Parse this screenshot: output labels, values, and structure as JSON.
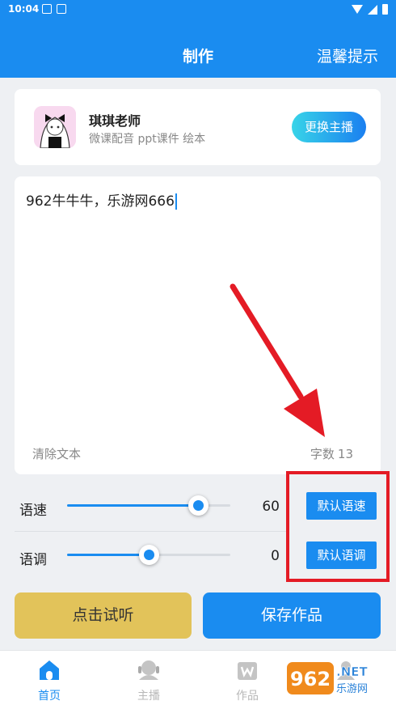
{
  "status_bar": {
    "time": "10:04"
  },
  "header": {
    "title": "制作",
    "tip_label": "温馨提示"
  },
  "anchor": {
    "name": "琪琪老师",
    "desc": "微课配音 ppt课件 绘本",
    "switch_label": "更换主播"
  },
  "editor": {
    "text": "962牛牛牛，乐游网666",
    "clear_label": "清除文本",
    "count_label": "字数",
    "count_value": "13"
  },
  "sliders": {
    "speed": {
      "label": "语速",
      "value": "60",
      "fraction": 0.8,
      "default_label": "默认语速"
    },
    "pitch": {
      "label": "语调",
      "value": "0",
      "fraction": 0.5,
      "default_label": "默认语调"
    }
  },
  "actions": {
    "listen_label": "点击试听",
    "save_label": "保存作品"
  },
  "tabbar": {
    "items": [
      {
        "label": "首页",
        "icon": "home-icon",
        "active": true
      },
      {
        "label": "主播",
        "icon": "headset-icon",
        "active": false
      },
      {
        "label": "作品",
        "icon": "works-icon",
        "active": false
      },
      {
        "label": "",
        "icon": "profile-icon",
        "active": false
      }
    ]
  },
  "watermark": {
    "brand": "962",
    "brand_suffix": ".NET",
    "site": "乐游网"
  },
  "colors": {
    "primary": "#1a8cf0",
    "listen": "#e2c35a",
    "annotation": "#e41b25"
  }
}
